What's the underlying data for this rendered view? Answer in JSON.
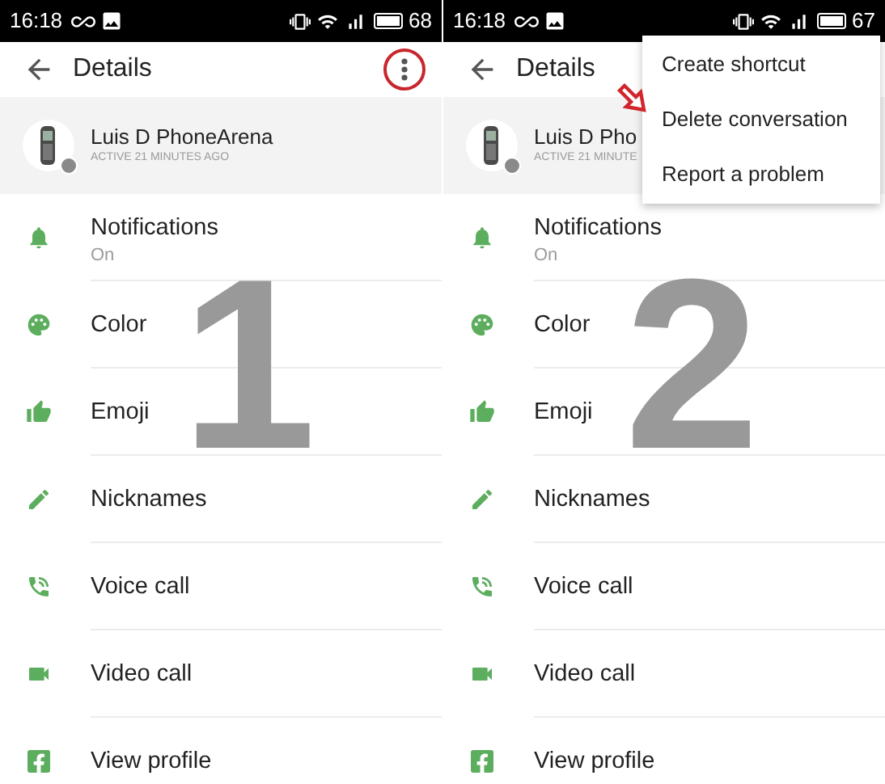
{
  "panels": [
    {
      "status_bar": {
        "time": "16:18",
        "battery": "68"
      },
      "header": {
        "title": "Details",
        "menu_button": {
          "highlighted": true
        }
      },
      "profile": {
        "name": "Luis D PhoneArena",
        "status": "ACTIVE 21 MINUTES AGO"
      },
      "items": [
        {
          "label": "Notifications",
          "sublabel": "On"
        },
        {
          "label": "Color"
        },
        {
          "label": "Emoji"
        },
        {
          "label": "Nicknames"
        },
        {
          "label": "Voice call"
        },
        {
          "label": "Video call"
        },
        {
          "label": "View profile"
        }
      ],
      "step_number": "1"
    },
    {
      "status_bar": {
        "time": "16:18",
        "battery": "67"
      },
      "header": {
        "title": "Details"
      },
      "profile": {
        "name": "Luis D Pho",
        "status": "ACTIVE 21 MINUTE"
      },
      "items": [
        {
          "label": "Notifications",
          "sublabel": "On"
        },
        {
          "label": "Color"
        },
        {
          "label": "Emoji"
        },
        {
          "label": "Nicknames"
        },
        {
          "label": "Voice call"
        },
        {
          "label": "Video call"
        },
        {
          "label": "View profile"
        }
      ],
      "step_number": "2",
      "menu": {
        "items": [
          {
            "label": "Create shortcut",
            "pointed": false
          },
          {
            "label": "Delete conversation",
            "pointed": true
          },
          {
            "label": "Report a problem",
            "pointed": false
          }
        ]
      }
    }
  ]
}
